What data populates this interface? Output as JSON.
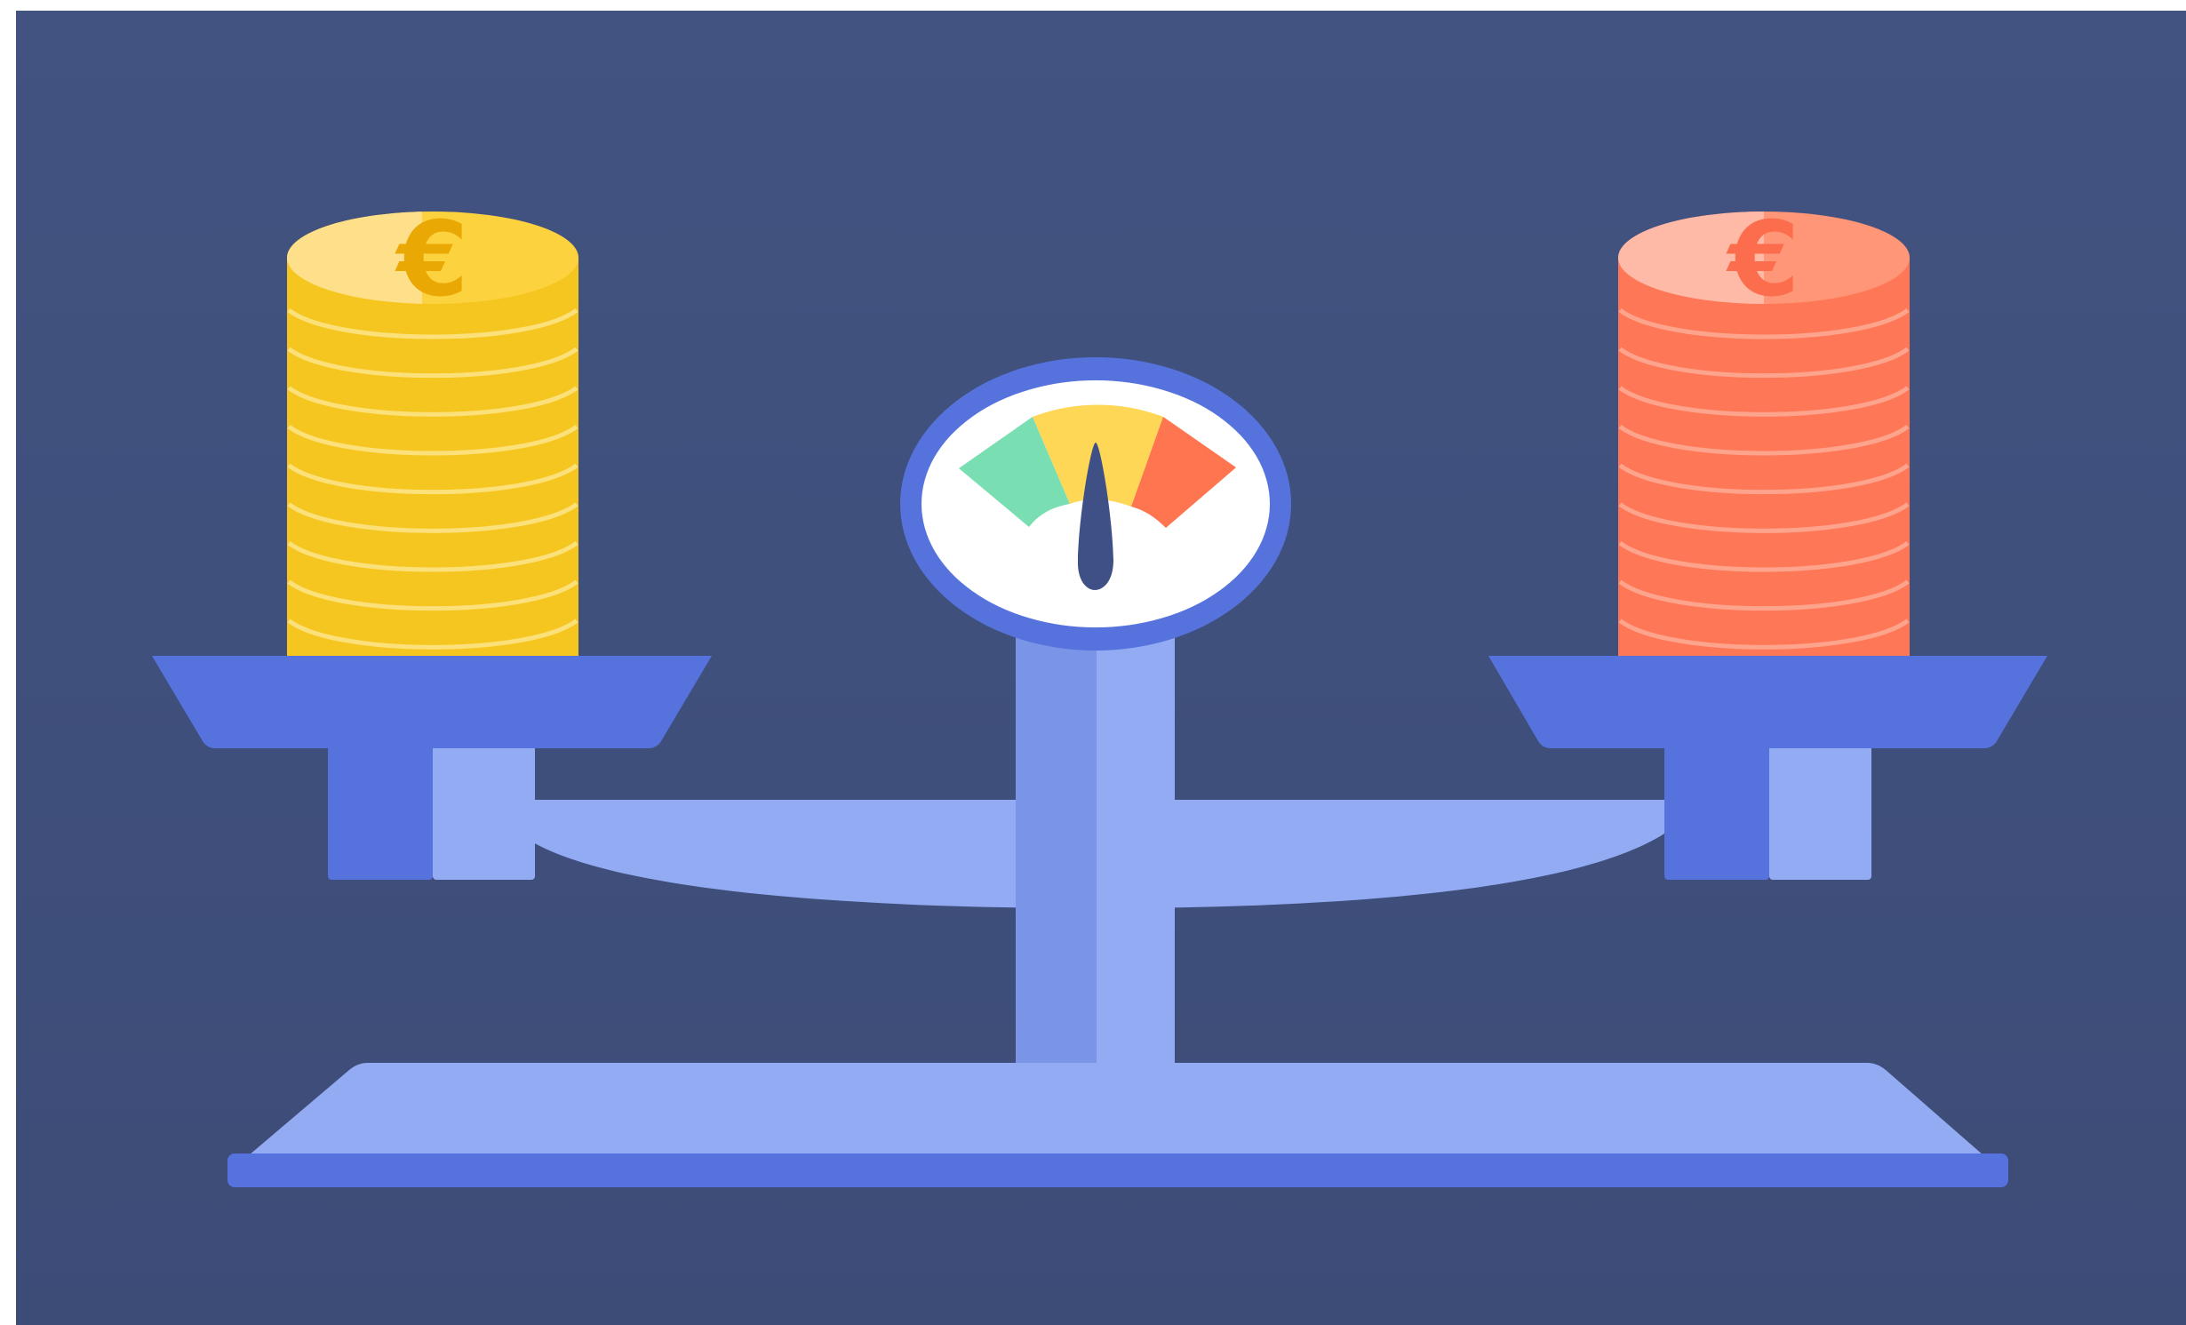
{
  "illustration": {
    "left_stack": {
      "symbol": "€",
      "coin_count": 9,
      "colors": {
        "top": "#fdd23f",
        "top_highlight": "#fee08a",
        "side": "#f6c620",
        "stripe": "#fde48a",
        "symbol": "#eaa805"
      }
    },
    "right_stack": {
      "symbol": "€",
      "coin_count": 9,
      "colors": {
        "top": "#fe9677",
        "top_highlight": "#febaa6",
        "side": "#fe7756",
        "stripe": "#feac97",
        "symbol": "#fb6d4d"
      }
    },
    "gauge": {
      "zones": [
        "green",
        "yellow",
        "red"
      ],
      "zone_colors": [
        "#79dfb3",
        "#fed757",
        "#ff7550"
      ],
      "needle_level": 0.5
    },
    "colors": {
      "background_top": "#425381",
      "background_bottom": "#3d4c77",
      "scale_dark": "#5673dd",
      "scale_mid": "#7a94e8",
      "scale_light": "#93abf3",
      "gauge_face": "#ffffff",
      "needle": "#3f5086"
    }
  }
}
